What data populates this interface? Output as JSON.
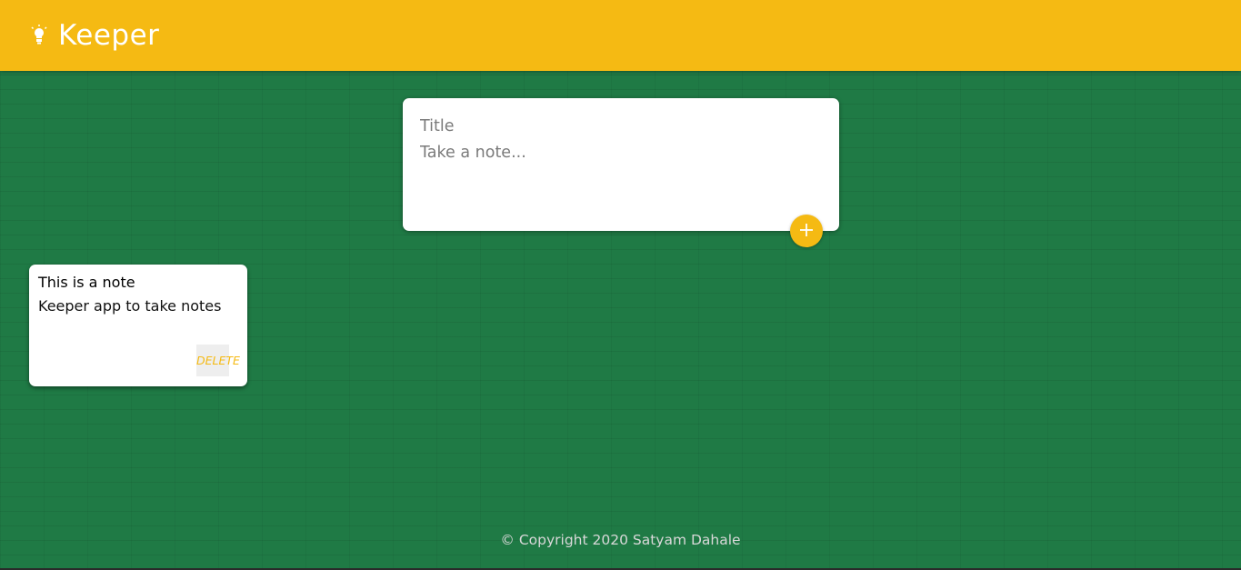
{
  "header": {
    "app_title": "Keeper",
    "logo_icon": "lightbulb-icon",
    "background_color": "#f5ba13"
  },
  "create_note": {
    "title_placeholder": "Title",
    "content_placeholder": "Take a note...",
    "add_icon": "plus-icon"
  },
  "notes": [
    {
      "title": "This is a note",
      "content": "Keeper app to take notes",
      "delete_label": "DELETE"
    }
  ],
  "footer": {
    "copyright": "© Copyright 2020 Satyam Dahale"
  },
  "colors": {
    "accent": "#f5ba13",
    "background": "#1f7a45"
  }
}
